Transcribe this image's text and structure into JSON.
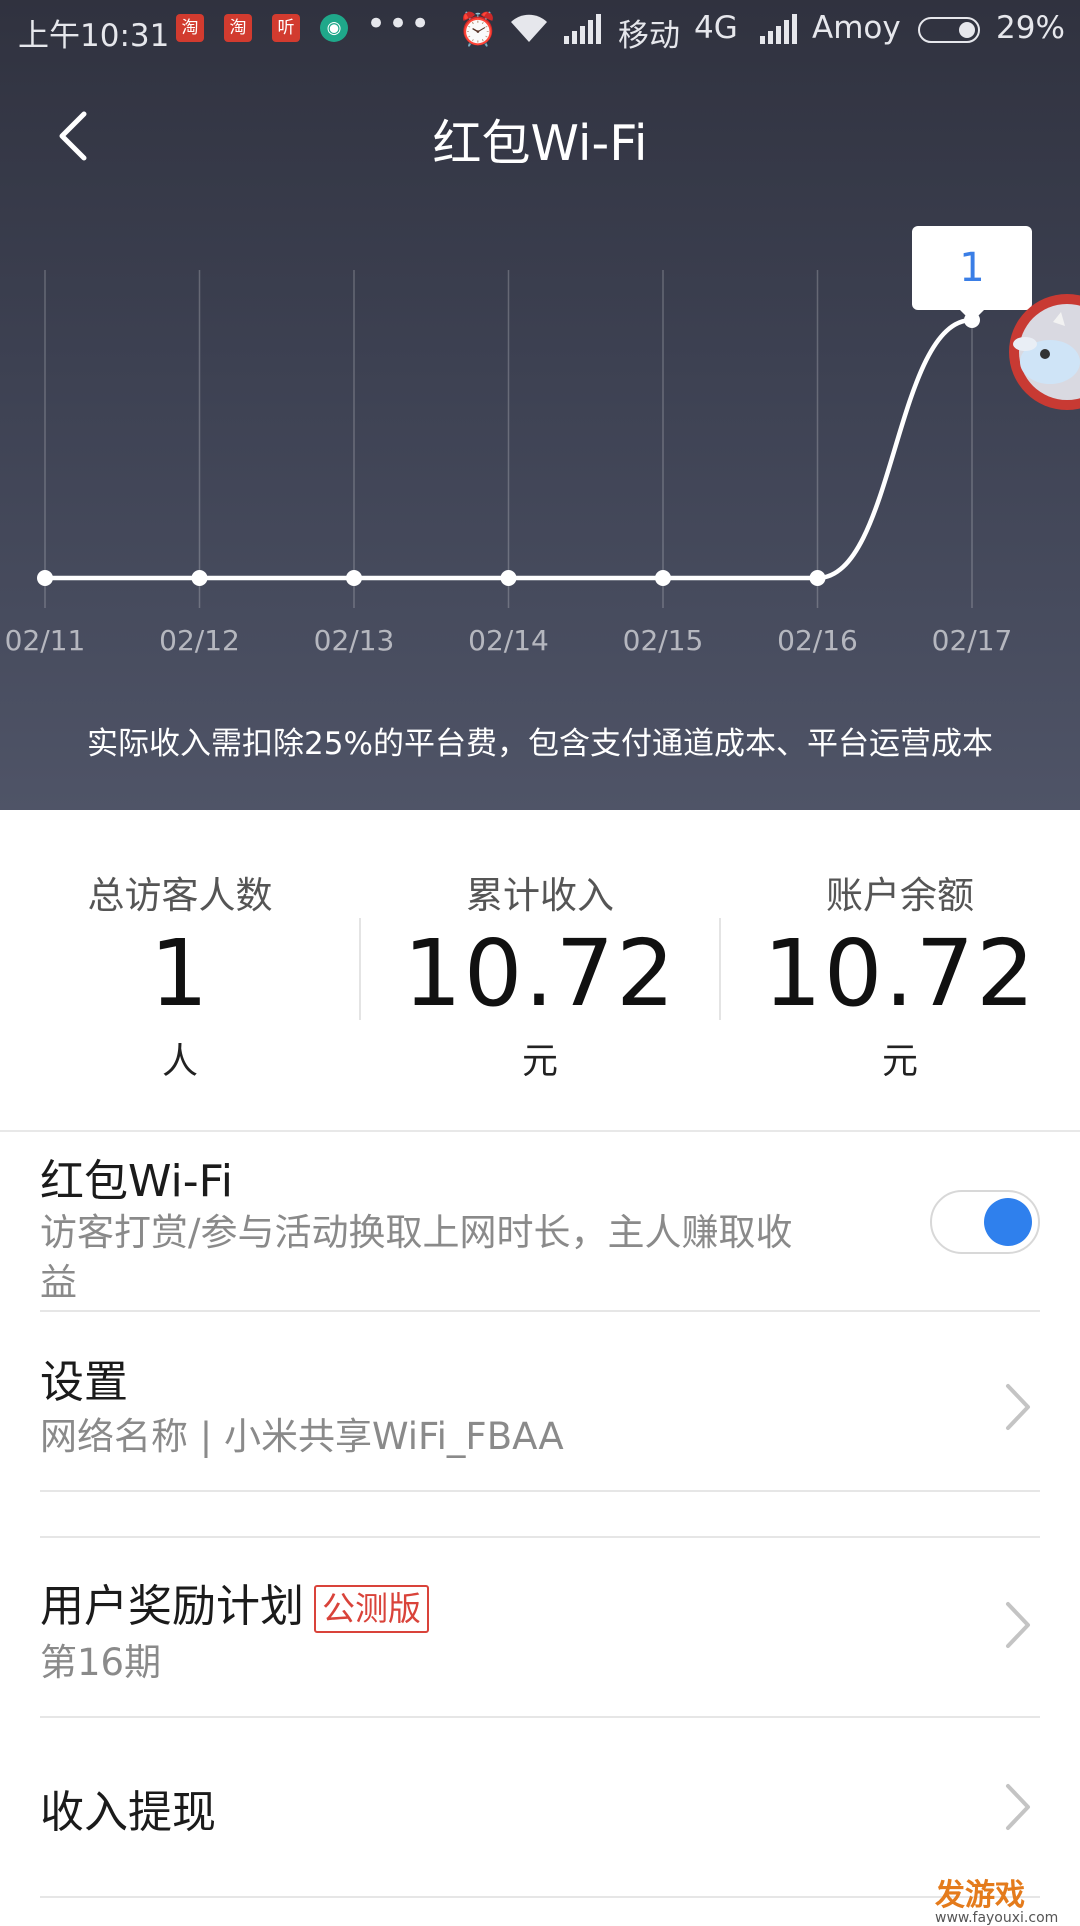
{
  "status_bar": {
    "time": "上午10:31",
    "notifications": [
      "淘",
      "淘",
      "听",
      "◉"
    ],
    "more": "•••",
    "carrier1": "移动",
    "network": "4G",
    "carrier2": "Amoy",
    "battery": "29%",
    "battery_level": 0.29
  },
  "header": {
    "title": "红包Wi-Fi"
  },
  "chart_data": {
    "type": "line",
    "categories": [
      "02/11",
      "02/12",
      "02/13",
      "02/14",
      "02/15",
      "02/16",
      "02/17"
    ],
    "values": [
      0,
      0,
      0,
      0,
      0,
      0,
      1
    ],
    "highlight": {
      "label": "1"
    },
    "line_color": "#ffffff"
  },
  "note": "实际收入需扣除25%的平台费，包含支付通道成本、平台运营成本",
  "stats": [
    {
      "label": "总访客人数",
      "value": "1",
      "unit": "人"
    },
    {
      "label": "累计收入",
      "value": "10.72",
      "unit": "元"
    },
    {
      "label": "账户余额",
      "value": "10.72",
      "unit": "元"
    }
  ],
  "list": {
    "wifi": {
      "title": "红包Wi-Fi",
      "subtitle_line1": "访客打赏/参与活动换取上网时长，主人赚取收",
      "subtitle_line2": "益",
      "enabled": true
    },
    "settings": {
      "title": "设置",
      "subtitle": "网络名称 |   小米共享WiFi_FBAA"
    },
    "rewards": {
      "title": "用户奖励计划",
      "badge": "公测版",
      "subtitle": "第16期"
    },
    "withdraw": {
      "title": "收入提现"
    }
  },
  "watermark": {
    "brand": "发游戏",
    "url": "www.fayouxi.com"
  },
  "colors": {
    "accent": "#2f80ed",
    "badge": "#d9433a",
    "header_bg": "#3d4152"
  }
}
